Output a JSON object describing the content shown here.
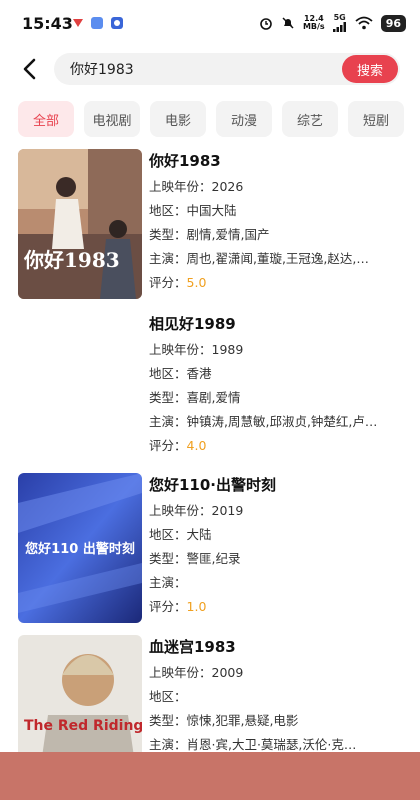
{
  "status": {
    "time": "15:43",
    "net_speed_value": "12.4",
    "net_speed_unit": "MB/s",
    "network": "5G",
    "battery": "96"
  },
  "search": {
    "query": "你好1983",
    "button_label": "搜索"
  },
  "tabs": [
    {
      "label": "全部",
      "active": true
    },
    {
      "label": "电视剧"
    },
    {
      "label": "电影"
    },
    {
      "label": "动漫"
    },
    {
      "label": "综艺"
    },
    {
      "label": "短剧"
    }
  ],
  "labels": {
    "year": "上映年份：",
    "region": "地区：",
    "type": "类型：",
    "cast": "主演：",
    "score": "评分："
  },
  "results": [
    {
      "title": "你好1983",
      "year": "2026",
      "region": "中国大陆",
      "type": "剧情,爱情,国产",
      "cast": "周也,翟潇闻,董璇,王冠逸,赵达,…",
      "score": "5.0",
      "poster_text": "你好1983"
    },
    {
      "title": "相见好1989",
      "year": "1989",
      "region": "香港",
      "type": "喜剧,爱情",
      "cast": "钟镇涛,周慧敏,邱淑贞,钟楚红,卢…",
      "score": "4.0",
      "poster_text": ""
    },
    {
      "title": "您好110·出警时刻",
      "year": "2019",
      "region": "大陆",
      "type": "警匪,纪录",
      "cast": "",
      "score": "1.0",
      "poster_text": "您好110 出警时刻"
    },
    {
      "title": "血迷宫1983",
      "year": "2009",
      "region": "",
      "type": "惊悚,犯罪,悬疑,电影",
      "cast": "肖恩·宾,大卫·莫瑞瑟,沃伦·克…",
      "score": "",
      "poster_text": "The Red Riding Trilogy"
    }
  ],
  "colors": {
    "accent": "#e8424f",
    "tab_active_bg": "#fde8ea",
    "score": "#f0a020",
    "bottom_bar": "#c87468"
  }
}
